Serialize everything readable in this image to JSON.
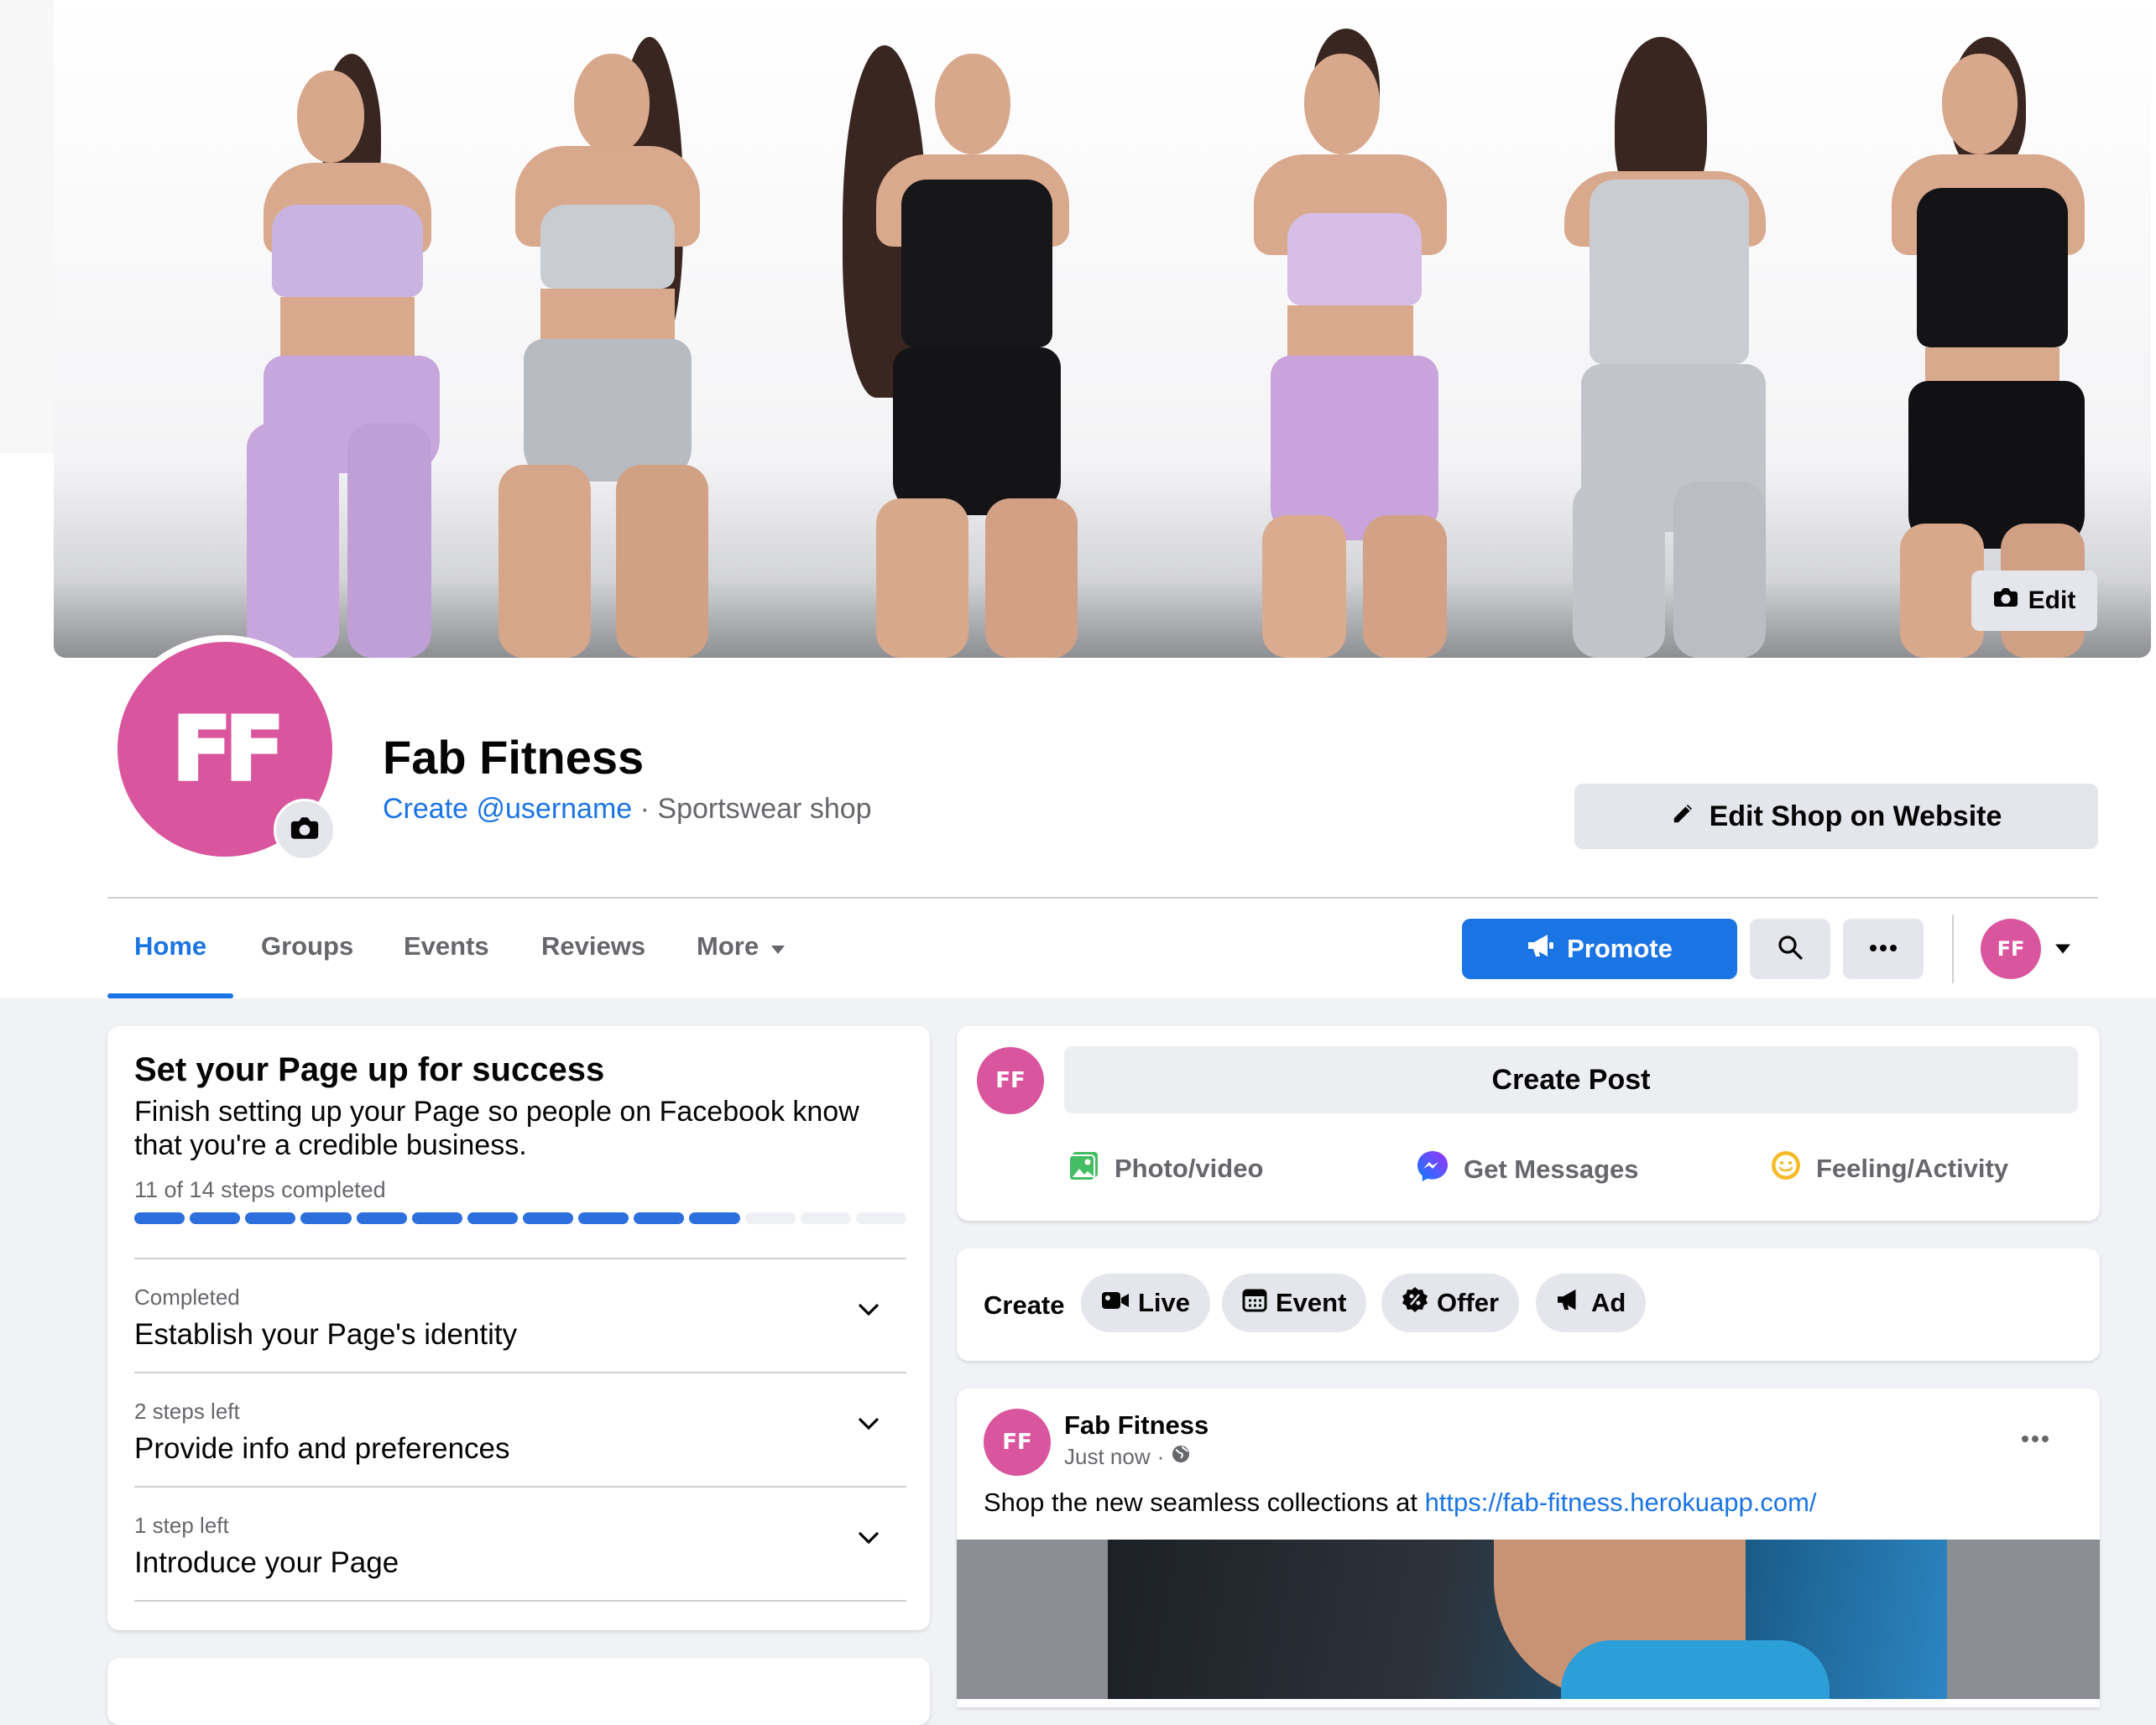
{
  "cover": {
    "edit_label": "Edit"
  },
  "profile": {
    "monogram": "FF",
    "name": "Fab Fitness",
    "username_link": "Create @username",
    "separator": " · ",
    "category": "Sportswear shop",
    "edit_shop_label": "Edit Shop on Website"
  },
  "tabs": [
    {
      "label": "Home",
      "active": true
    },
    {
      "label": "Groups"
    },
    {
      "label": "Events"
    },
    {
      "label": "Reviews"
    },
    {
      "label": "More"
    }
  ],
  "actions": {
    "promote_label": "Promote"
  },
  "setup": {
    "title": "Set your Page up for success",
    "description": "Finish setting up your Page so people on Facebook know that you're a credible business.",
    "steps_label": "11 of 14 steps completed",
    "progress_done": 11,
    "progress_total": 14,
    "sections": [
      {
        "status": "Completed",
        "title": "Establish your Page's identity"
      },
      {
        "status": "2 steps left",
        "title": "Provide info and preferences"
      },
      {
        "status": "1 step left",
        "title": "Introduce your Page"
      }
    ]
  },
  "composer": {
    "create_post_label": "Create Post",
    "actions": [
      {
        "label": "Photo/video",
        "icon": "photo-icon"
      },
      {
        "label": "Get Messages",
        "icon": "messenger-icon"
      },
      {
        "label": "Feeling/Activity",
        "icon": "smiley-icon"
      }
    ]
  },
  "create_bar": {
    "label": "Create",
    "chips": [
      {
        "label": "Live",
        "icon": "live-video-icon"
      },
      {
        "label": "Event",
        "icon": "calendar-icon"
      },
      {
        "label": "Offer",
        "icon": "offer-icon"
      },
      {
        "label": "Ad",
        "icon": "megaphone-icon"
      }
    ]
  },
  "post": {
    "author": "Fab Fitness",
    "time": "Just now",
    "meta_sep": "·",
    "text": "Shop the new seamless collections at ",
    "link": "https://fab-fitness.herokuapp.com/"
  },
  "colors": {
    "brand_pink": "#d9559e",
    "facebook_blue": "#1b74e4",
    "progress_done": "#2d6fdc",
    "progress_todo": "#eef0f3"
  }
}
